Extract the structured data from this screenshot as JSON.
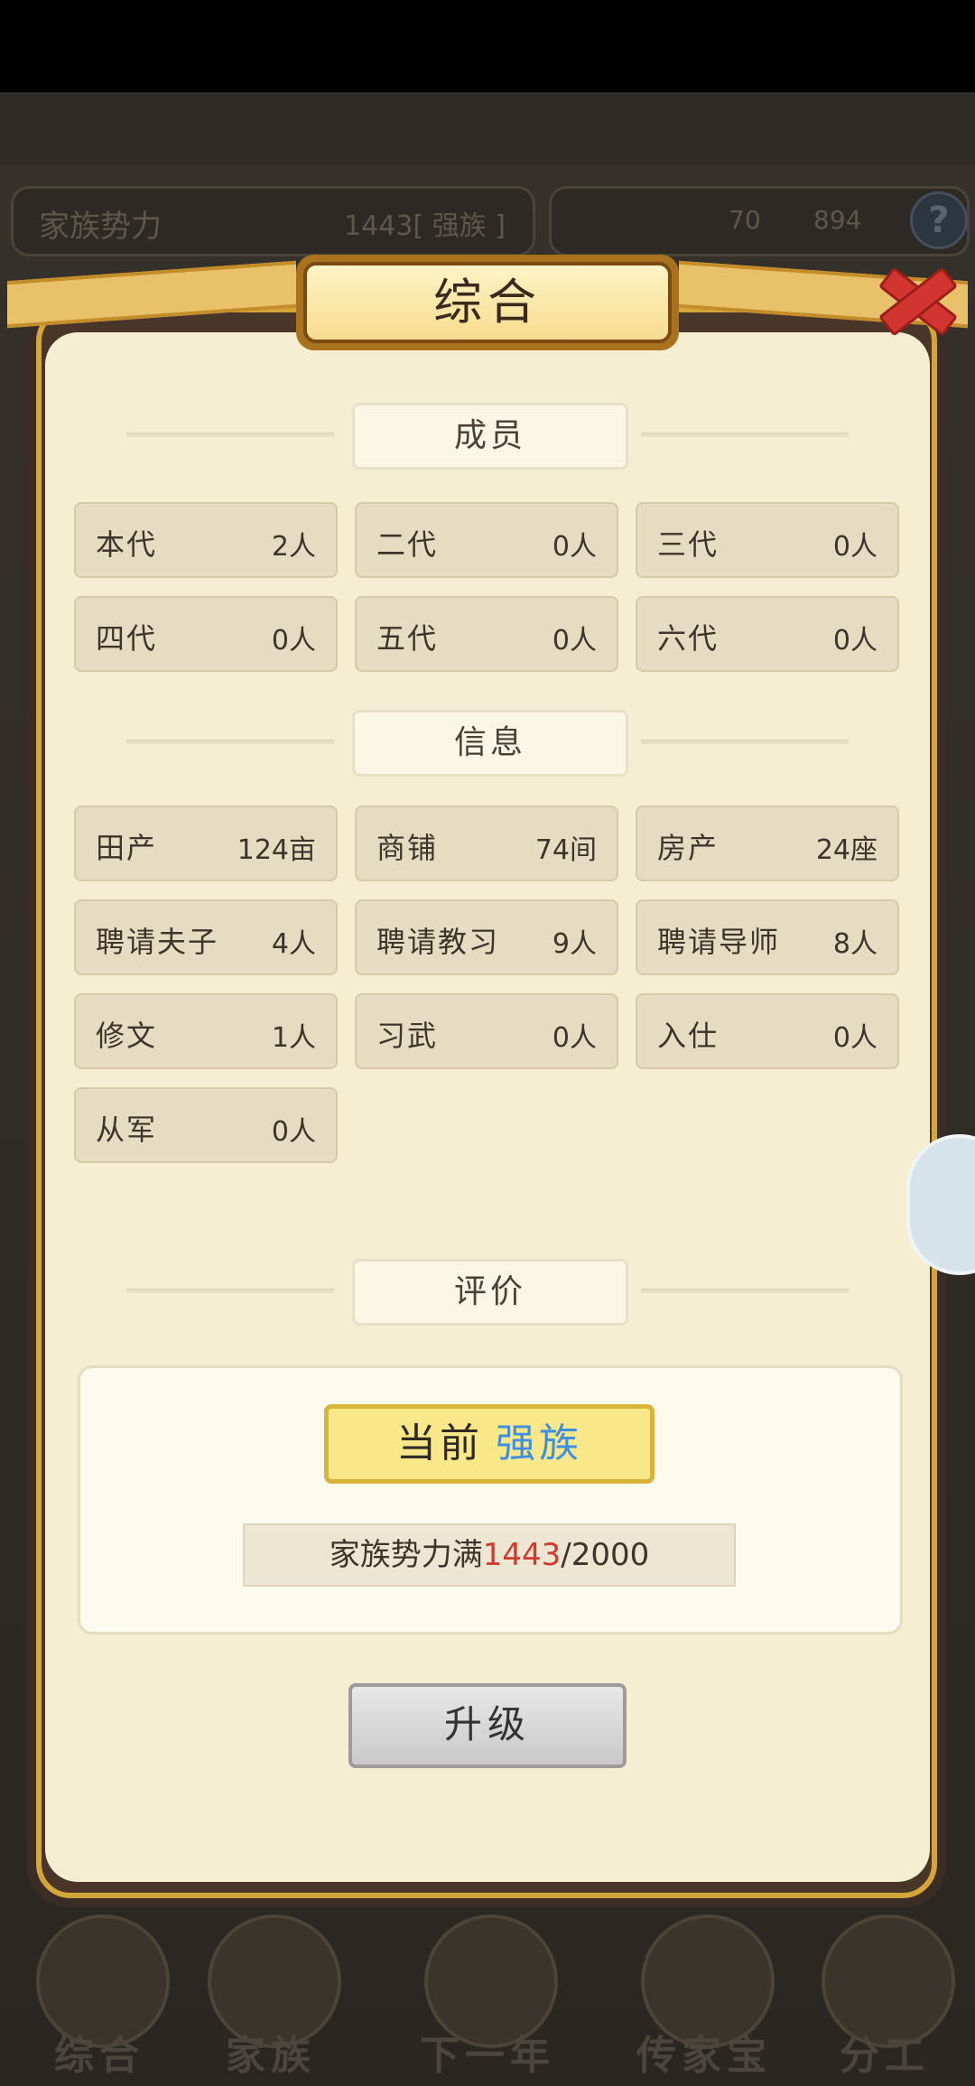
{
  "hud": {
    "family_power_label": "家族势力",
    "family_power_value": "1443[ 强族 ]",
    "gems": "70",
    "coins": "894",
    "help": "?"
  },
  "dialog": {
    "title": "综合",
    "sections": {
      "members": "成员",
      "info": "信息",
      "evaluation": "评价"
    },
    "members": [
      {
        "label": "本代",
        "value": "2人"
      },
      {
        "label": "二代",
        "value": "0人"
      },
      {
        "label": "三代",
        "value": "0人"
      },
      {
        "label": "四代",
        "value": "0人"
      },
      {
        "label": "五代",
        "value": "0人"
      },
      {
        "label": "六代",
        "value": "0人"
      }
    ],
    "info": [
      {
        "label": "田产",
        "value": "124亩"
      },
      {
        "label": "商铺",
        "value": "74间"
      },
      {
        "label": "房产",
        "value": "24座"
      },
      {
        "label": "聘请夫子",
        "value": "4人"
      },
      {
        "label": "聘请教习",
        "value": "9人"
      },
      {
        "label": "聘请导师",
        "value": "8人"
      },
      {
        "label": "修文",
        "value": "1人"
      },
      {
        "label": "习武",
        "value": "0人"
      },
      {
        "label": "入仕",
        "value": "0人"
      },
      {
        "label": "从军",
        "value": "0人"
      }
    ],
    "evaluation": {
      "prefix": "当前",
      "rank": "强族",
      "progress_label": "家族势力满",
      "progress_current": "1443",
      "progress_max": "/2000"
    },
    "upgrade_label": "升级"
  },
  "bottom_nav": [
    {
      "label": "综合"
    },
    {
      "label": "家族"
    },
    {
      "label": "下一年"
    },
    {
      "label": "传家宝"
    },
    {
      "label": "分工"
    }
  ]
}
